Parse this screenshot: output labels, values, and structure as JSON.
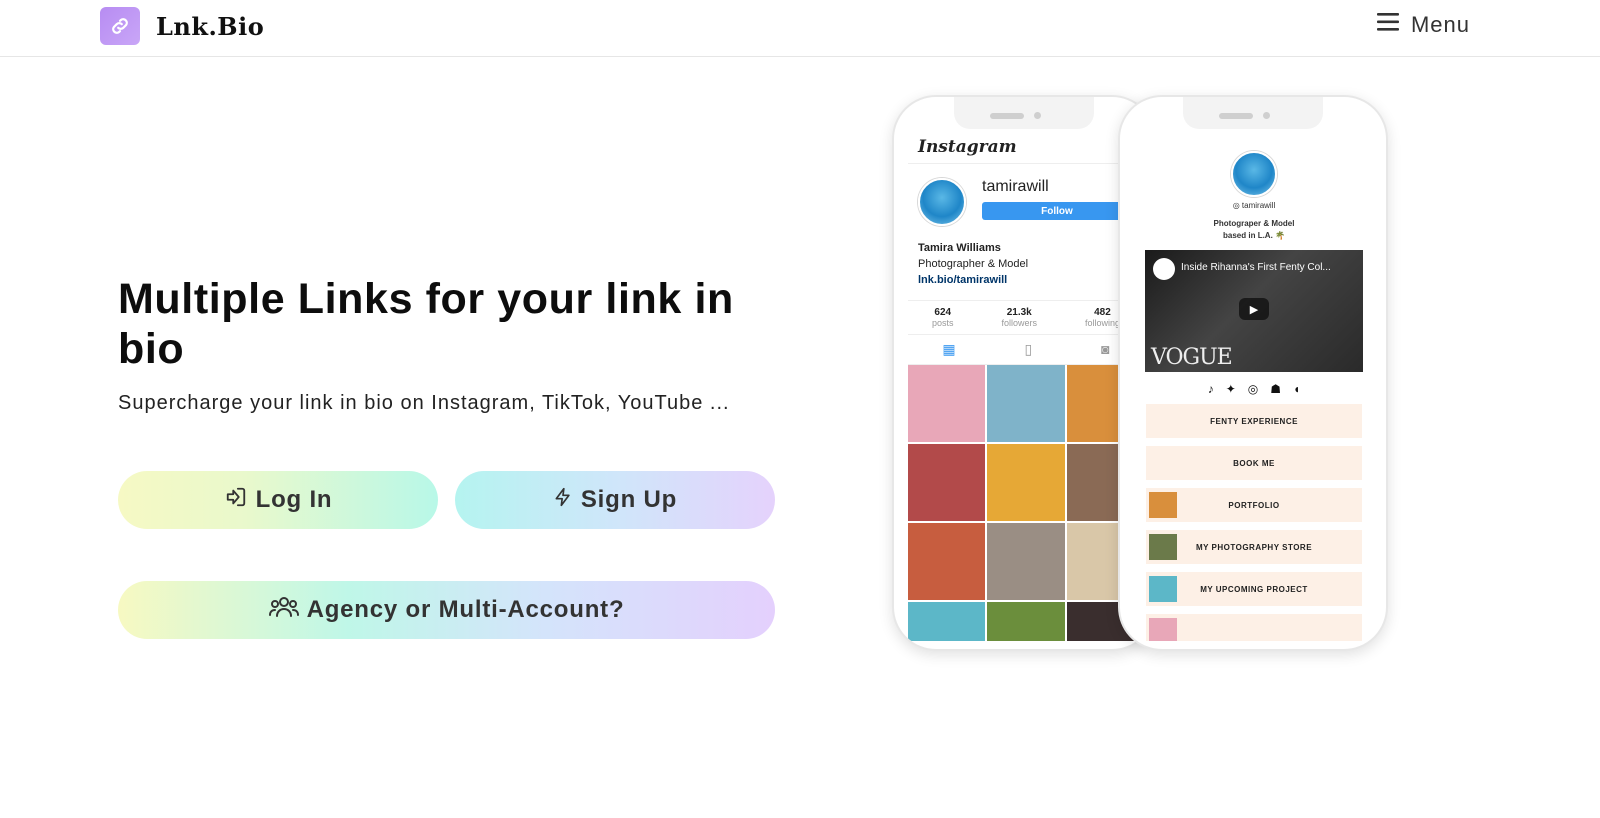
{
  "brand": {
    "name": "Lnk.Bio",
    "logo_icon": "link-icon",
    "logo_color": "#b78cf2"
  },
  "menu": {
    "label": "Menu",
    "icon": "hamburger-icon"
  },
  "hero": {
    "title": "Multiple Links for your link in bio",
    "subtitle": "Supercharge your link in bio on Instagram, TikTok, YouTube ..."
  },
  "buttons": {
    "login": {
      "label": "Log In",
      "icon": "login-icon"
    },
    "signup": {
      "label": "Sign Up",
      "icon": "bolt-icon"
    },
    "agency": {
      "label": "Agency or Multi-Account?",
      "icon": "users-icon"
    }
  },
  "instagram_mock": {
    "logo": "Instagram",
    "username": "tamirawill",
    "follow_label": "Follow",
    "name": "Tamira Williams",
    "bio": "Photographer & Model",
    "link": "lnk.bio/tamirawill",
    "stats": [
      {
        "value": "624",
        "label": "posts"
      },
      {
        "value": "21.3k",
        "label": "followers"
      },
      {
        "value": "482",
        "label": "following"
      }
    ],
    "accent": "#3897f0"
  },
  "lnk_mock": {
    "handle": "tamirawill",
    "bio_line1": "Photograper & Model",
    "bio_line2": "based in L.A. 🌴",
    "video_title": "Inside Rihanna's First Fenty Col...",
    "video_brand": "VOGUE",
    "links": [
      "FENTY EXPERIENCE",
      "BOOK ME",
      "PORTFOLIO",
      "MY PHOTOGRAPHY STORE",
      "MY UPCOMING PROJECT"
    ],
    "link_bg": "#fdf0e6"
  }
}
